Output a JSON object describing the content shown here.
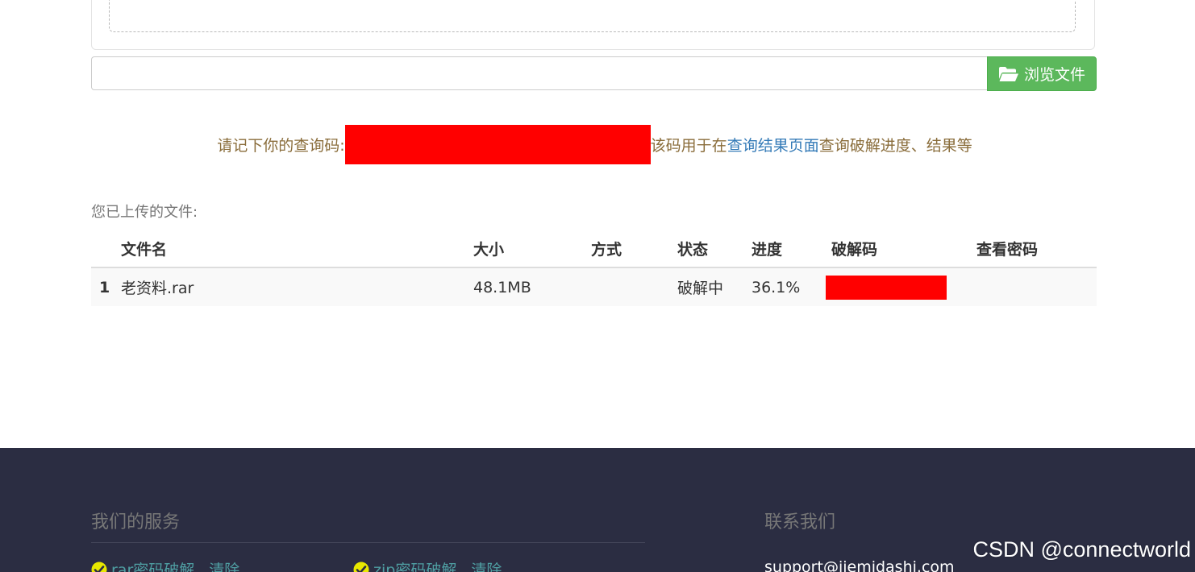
{
  "upload": {
    "browse_label": "浏览文件",
    "file_input_value": ""
  },
  "query": {
    "prefix": "请记下你的查询码:",
    "code": "[redacted]",
    "middle": "该码用于在",
    "link_text": "查询结果页面",
    "suffix": "查询破解进度、结果等"
  },
  "uploaded": {
    "title": "您已上传的文件:",
    "columns": [
      "",
      "文件名",
      "大小",
      "方式",
      "状态",
      "进度",
      "破解码",
      "查看密码"
    ],
    "rows": [
      {
        "index": "1",
        "name": "老资料.rar",
        "size": "48.1MB",
        "method": "",
        "status": "破解中",
        "progress": "36.1%",
        "crack_code": "[redacted]",
        "password": ""
      }
    ]
  },
  "footer": {
    "services_title": "我们的服务",
    "contact_title": "联系我们",
    "services": [
      {
        "label": "rar密码破解",
        "clear": "清除"
      },
      {
        "label": "zip密码破解",
        "clear": "清除"
      }
    ],
    "email": "support@jiemidashi.com"
  },
  "watermark": "CSDN @connectworld",
  "colors": {
    "button_green": "#5cb85c",
    "query_text": "#8a6d3b",
    "link_blue": "#337ab7",
    "redaction": "#ff0000",
    "footer_bg": "#2b2d42",
    "service_link": "#4f9fa3",
    "check_yellow": "#e8e800"
  }
}
